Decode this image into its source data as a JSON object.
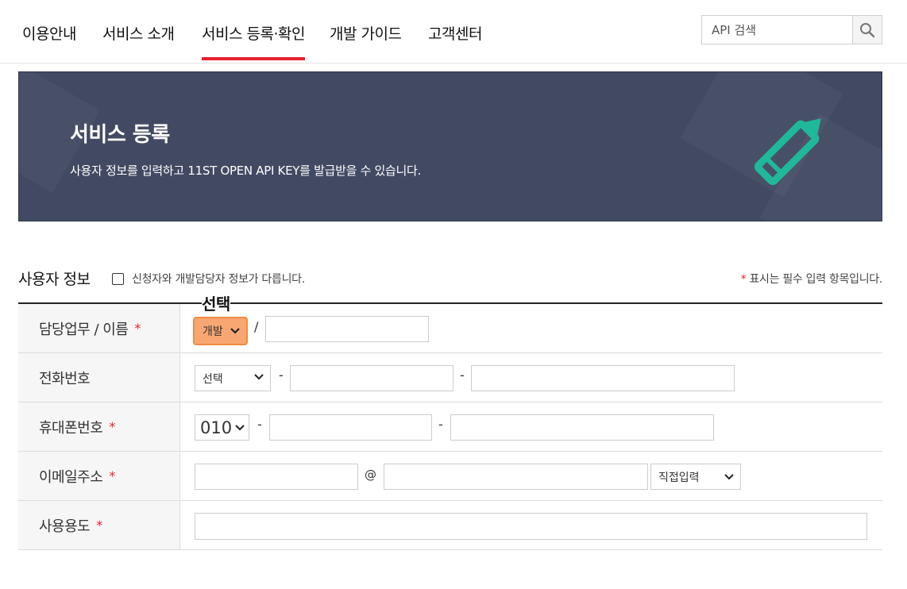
{
  "nav": {
    "items": [
      "이용안내",
      "서비스 소개",
      "서비스 등록·확인",
      "개발 가이드",
      "고객센터"
    ],
    "active_index": 2
  },
  "search": {
    "placeholder": "API 검색",
    "icon": "search-icon"
  },
  "banner": {
    "title": "서비스 등록",
    "description": "사용자 정보를 입력하고 11ST OPEN API KEY를 발급받을 수 있습니다.",
    "icon": "pencil-icon",
    "background_color": "#424a63",
    "icon_color": "#1fb89b"
  },
  "section": {
    "title": "사용자 정보",
    "checkbox_label": "신청자와 개발담당자 정보가 다릅니다.",
    "required_star": "*",
    "required_note": "표시는 필수 입력 항목입니다."
  },
  "callout": {
    "label": "선택"
  },
  "form": {
    "rows": [
      {
        "label": "담당업무 / 이름",
        "required": "*"
      },
      {
        "label": "전화번호",
        "required": ""
      },
      {
        "label": "휴대폰번호",
        "required": "*"
      },
      {
        "label": "이메일주소",
        "required": "*"
      },
      {
        "label": "사용용도",
        "required": "*"
      }
    ],
    "job_select_value": "개발",
    "slash": "/",
    "phone_select_value": "선택",
    "mobile_select_value": "010",
    "dash": "-",
    "at_sign": "@",
    "email_domain_select_value": "직접입력"
  },
  "colors": {
    "accent_red": "#e8202c",
    "highlight_orange": "#f9a772"
  }
}
